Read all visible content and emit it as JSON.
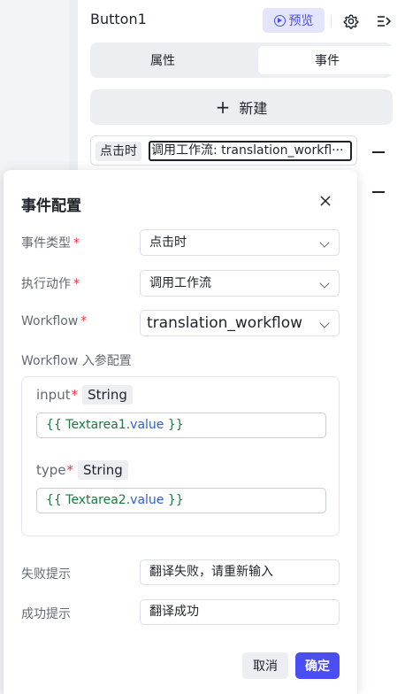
{
  "panel": {
    "title": "Button1",
    "preview_label": "预览",
    "tabs": [
      {
        "label": "属性"
      },
      {
        "label": "事件"
      }
    ],
    "new_label": "新建",
    "event": {
      "trigger": "点击时",
      "action": "调用工作流: translation_workfl···"
    }
  },
  "modal": {
    "title": "事件配置",
    "event_type": {
      "label": "事件类型",
      "value": "点击时"
    },
    "action": {
      "label": "执行动作",
      "value": "调用工作流"
    },
    "workflow": {
      "label": "Workflow",
      "value": "translation_workflow"
    },
    "params_title": "Workflow 入参配置",
    "params": [
      {
        "name": "input",
        "type": "String",
        "expr_open": "{{ ",
        "expr_obj": "Textarea1.",
        "expr_prop": "value",
        "expr_close": " }}"
      },
      {
        "name": "type",
        "type": "String",
        "expr_open": "{{ ",
        "expr_obj": "Textarea2.",
        "expr_prop": "value",
        "expr_close": " }}"
      }
    ],
    "fail": {
      "label": "失败提示",
      "value": "翻译失败，请重新输入"
    },
    "success": {
      "label": "成功提示",
      "value": "翻译成功"
    },
    "cancel_label": "取消",
    "ok_label": "确定"
  },
  "colors": {
    "accent": "#4a4df0",
    "required": "#e5343e",
    "expr_object": "#1a7a3c",
    "expr_property": "#2d5fd8"
  },
  "icons": [
    "play-circle-icon",
    "gear-icon",
    "collapse-panel-icon",
    "plus-icon",
    "minus-icon",
    "close-icon",
    "chevron-down-icon"
  ]
}
